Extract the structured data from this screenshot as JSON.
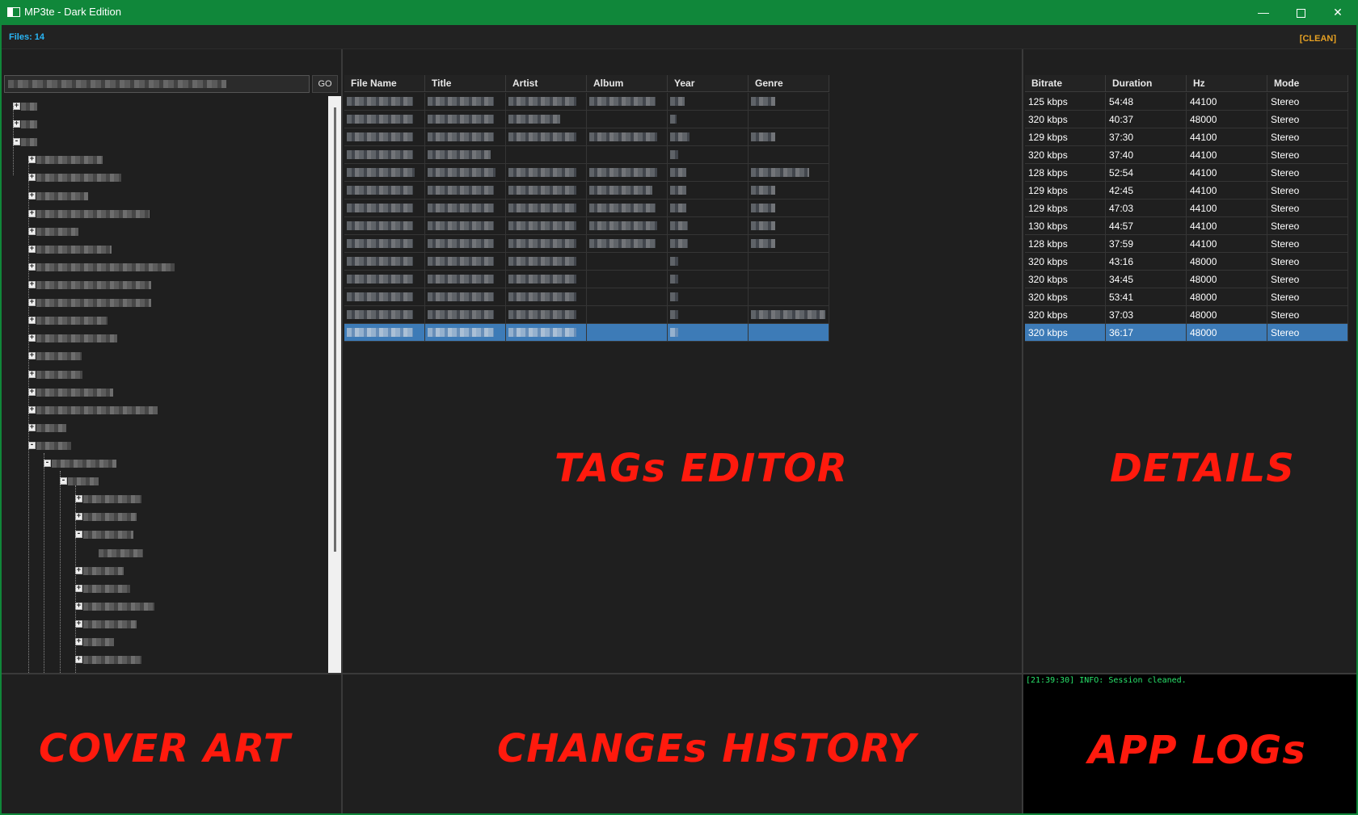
{
  "window": {
    "title": "MP3te - Dark Edition",
    "controls": {
      "minimize": "—",
      "maximize": "",
      "close": "✕"
    }
  },
  "status": {
    "files": "Files: 14",
    "session": "[CLEAN]"
  },
  "tree_panel": {
    "go_label": "GO"
  },
  "tags_editor": {
    "label": "TAGs EDITOR",
    "columns": [
      "File Name",
      "Title",
      "Artist",
      "Album",
      "Year",
      "Genre"
    ],
    "row_count": 14,
    "selected_row": 14
  },
  "details": {
    "label": "DETAILS",
    "columns": [
      "Bitrate",
      "Duration",
      "Hz",
      "Mode"
    ],
    "rows": [
      [
        "125 kbps",
        "54:48",
        "44100",
        "Stereo"
      ],
      [
        "320 kbps",
        "40:37",
        "48000",
        "Stereo"
      ],
      [
        "129 kbps",
        "37:30",
        "44100",
        "Stereo"
      ],
      [
        "320 kbps",
        "37:40",
        "44100",
        "Stereo"
      ],
      [
        "128 kbps",
        "52:54",
        "44100",
        "Stereo"
      ],
      [
        "129 kbps",
        "42:45",
        "44100",
        "Stereo"
      ],
      [
        "129 kbps",
        "47:03",
        "44100",
        "Stereo"
      ],
      [
        "130 kbps",
        "44:57",
        "44100",
        "Stereo"
      ],
      [
        "128 kbps",
        "37:59",
        "44100",
        "Stereo"
      ],
      [
        "320 kbps",
        "43:16",
        "48000",
        "Stereo"
      ],
      [
        "320 kbps",
        "34:45",
        "48000",
        "Stereo"
      ],
      [
        "320 kbps",
        "53:41",
        "48000",
        "Stereo"
      ],
      [
        "320 kbps",
        "37:03",
        "48000",
        "Stereo"
      ],
      [
        "320 kbps",
        "36:17",
        "48000",
        "Stereo"
      ]
    ],
    "selected_row": 14
  },
  "bottom": {
    "cover_art": "COVER ART",
    "history": "CHANGEs HISTORY",
    "logs_label": "APP LOGs",
    "log_line": "[21:39:30] INFO: Session cleaned."
  },
  "colors": {
    "titlebar": "#10873a",
    "accent": "#29b6f6",
    "clean": "#e5a023",
    "selected": "#3d7bb7",
    "overlay": "#ff1a0d",
    "log": "#29e36b"
  }
}
